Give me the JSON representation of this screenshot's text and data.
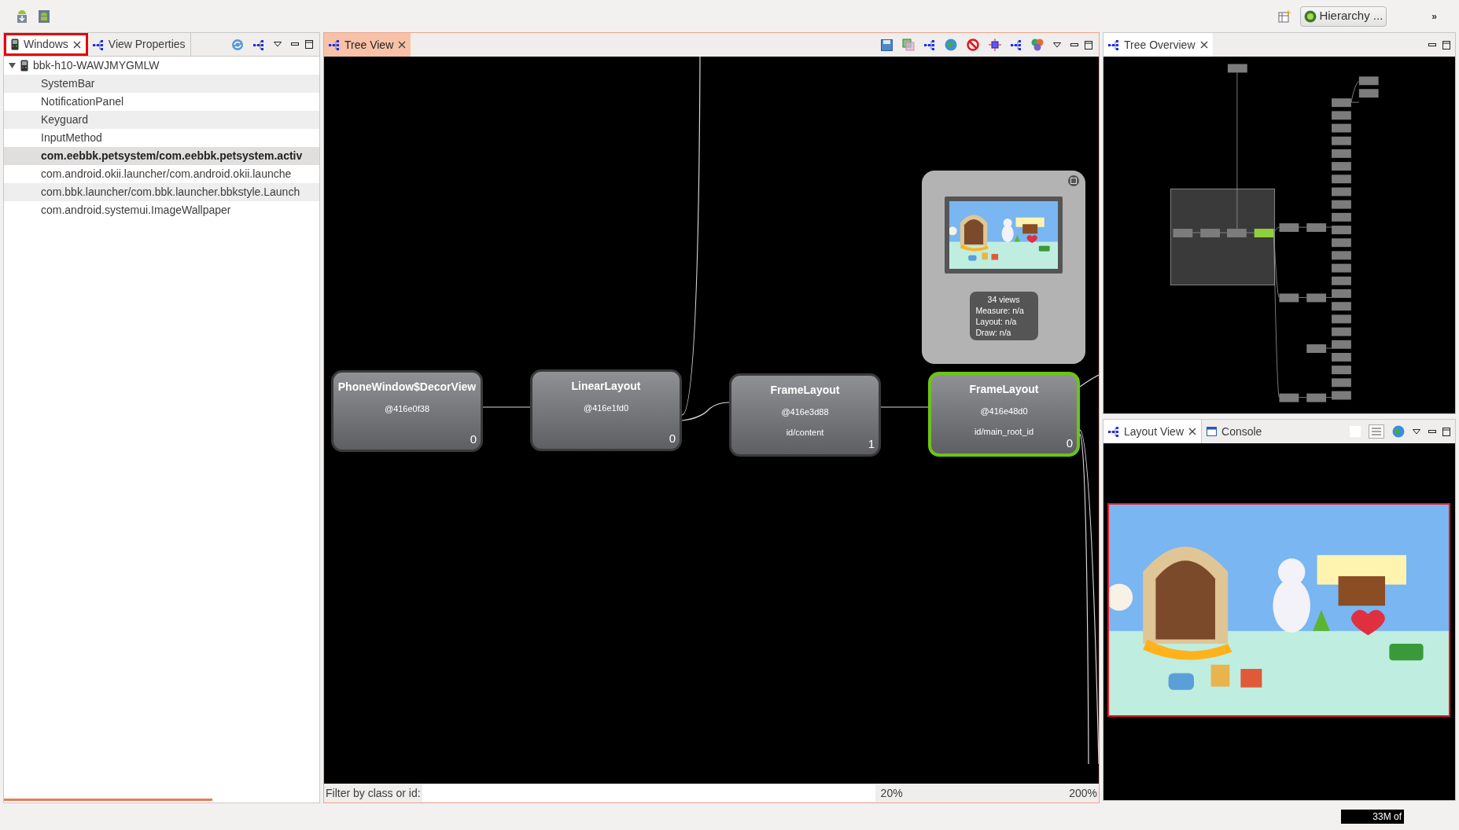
{
  "toolbar": {
    "perspective_button": "Hierarchy ...",
    "overflow": "»"
  },
  "left_panel": {
    "tabs": [
      {
        "label": "Windows",
        "selected": true,
        "highlighted": true
      },
      {
        "label": "View Properties",
        "selected": false,
        "highlighted": false
      }
    ],
    "device": {
      "name": "bbk-h10-WAWJMYGMLW",
      "expanded": true,
      "children": [
        {
          "label": "SystemBar",
          "selected": false
        },
        {
          "label": "NotificationPanel",
          "selected": false
        },
        {
          "label": "Keyguard",
          "selected": false
        },
        {
          "label": "InputMethod",
          "selected": false
        },
        {
          "label": "com.eebbk.petsystem/com.eebbk.petsystem.activ",
          "selected": true
        },
        {
          "label": "com.android.okii.launcher/com.android.okii.launche",
          "selected": false
        },
        {
          "label": "com.bbk.launcher/com.bbk.launcher.bbkstyle.Launch",
          "selected": false
        },
        {
          "label": "com.android.systemui.ImageWallpaper",
          "selected": false
        }
      ]
    }
  },
  "tree_view": {
    "tab": {
      "label": "Tree View",
      "selected": true
    },
    "nodes": [
      {
        "name": "PhoneWindow$DecorView",
        "address": "@416e0f38",
        "count": "0",
        "selected": false
      },
      {
        "name": "LinearLayout",
        "address": "@416e1fd0",
        "count": "0",
        "selected": false
      },
      {
        "name": "FrameLayout",
        "address": "@416e3d88",
        "id": "id/content",
        "count": "1",
        "selected": false
      },
      {
        "name": "FrameLayout",
        "address": "@416e48d0",
        "id": "id/main_root_id",
        "count": "0",
        "selected": true
      }
    ],
    "popup": {
      "views": "34 views",
      "measure": "Measure: n/a",
      "layout": "Layout: n/a",
      "draw": "Draw: n/a"
    },
    "filter": {
      "label": "Filter by class or id:"
    },
    "zoom_min": "20%",
    "zoom_max": "200%"
  },
  "tree_overview": {
    "tab": {
      "label": "Tree Overview",
      "selected": true
    }
  },
  "bottom_panel": {
    "tabs": [
      {
        "label": "Layout View",
        "selected": true
      },
      {
        "label": "Console",
        "selected": false
      }
    ]
  },
  "status_bar": {
    "heap": "33M of"
  }
}
